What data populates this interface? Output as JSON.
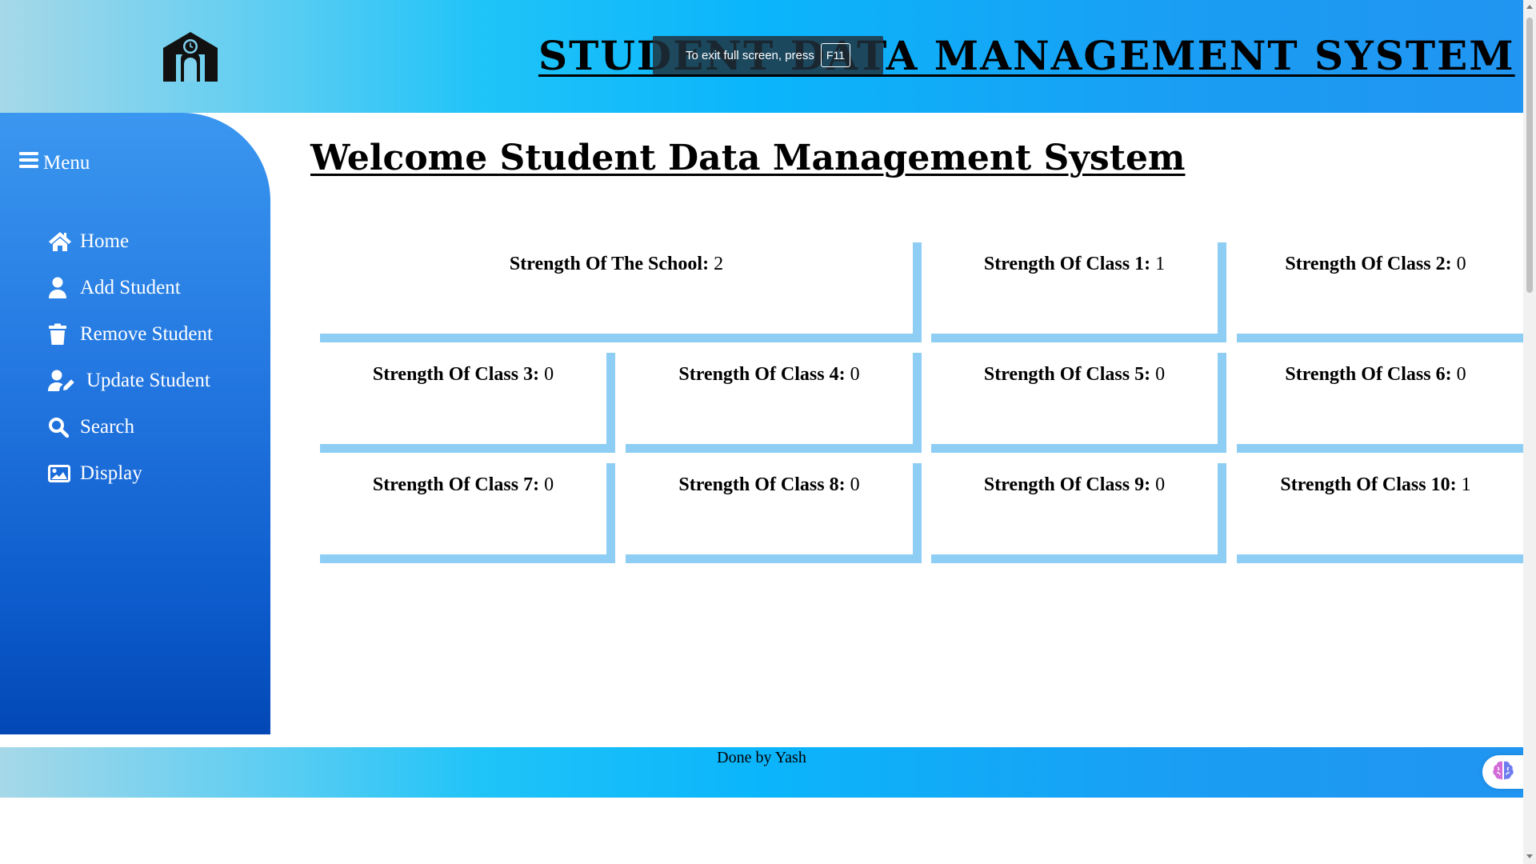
{
  "header": {
    "logo_icon": "school-icon",
    "title": "STUDENT DATA MANAGEMENT SYSTEM"
  },
  "fullscreen_toast": {
    "text": "To exit full screen, press",
    "key": "F11"
  },
  "sidebar": {
    "menu_label": "Menu",
    "menu_icon": "hamburger-icon",
    "items": [
      {
        "label": "Home",
        "icon": "home-icon"
      },
      {
        "label": "Add Student",
        "icon": "user-icon"
      },
      {
        "label": "Remove Student",
        "icon": "trash-icon"
      },
      {
        "label": "Update Student",
        "icon": "user-edit-icon"
      },
      {
        "label": "Search",
        "icon": "search-icon"
      },
      {
        "label": "Display",
        "icon": "image-icon"
      }
    ]
  },
  "main": {
    "heading": "Welcome Student Data Management System",
    "cards": [
      {
        "label": "Strength Of The School:",
        "value": "2"
      },
      {
        "label": "Strength Of Class 1:",
        "value": "1"
      },
      {
        "label": "Strength Of Class 2:",
        "value": "0"
      },
      {
        "label": "Strength Of Class 3:",
        "value": "0"
      },
      {
        "label": "Strength Of Class 4:",
        "value": "0"
      },
      {
        "label": "Strength Of Class 5:",
        "value": "0"
      },
      {
        "label": "Strength Of Class 6:",
        "value": "0"
      },
      {
        "label": "Strength Of Class 7:",
        "value": "0"
      },
      {
        "label": "Strength Of Class 8:",
        "value": "0"
      },
      {
        "label": "Strength Of Class 9:",
        "value": "0"
      },
      {
        "label": "Strength Of Class 10:",
        "value": "1"
      }
    ]
  },
  "footer": {
    "credit": "Done by Yash",
    "fab_icon": "brain-icon"
  },
  "colors": {
    "header_gradient": [
      "#a6d8e8",
      "#1ec3f8",
      "#2095f1"
    ],
    "sidebar_gradient": [
      "#3a97f0",
      "#0248b5"
    ],
    "card_border": "#8ecdf4"
  }
}
